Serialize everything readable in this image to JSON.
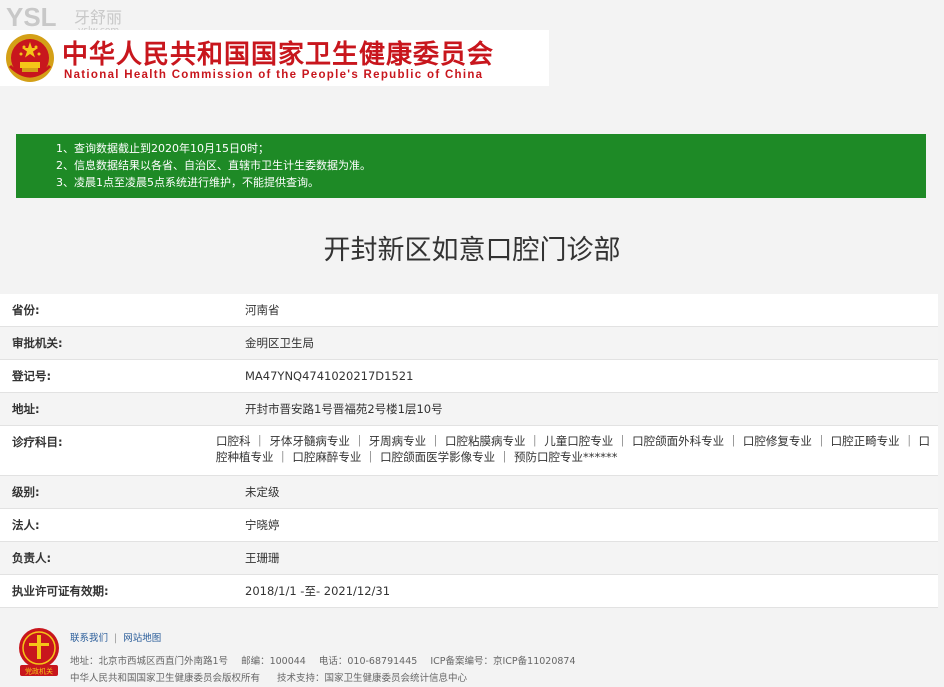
{
  "watermark": {
    "logo": "YSL",
    "name": "牙舒丽",
    "url": "yslw.com"
  },
  "header": {
    "title_cn": "中华人民共和国国家卫生健康委员会",
    "title_en": "National Health Commission of the People's Republic of China"
  },
  "notice": {
    "lines": [
      "1、查询数据截止到2020年10月15日0时；",
      "2、信息数据结果以各省、自治区、直辖市卫生计生委数据为准。",
      "3、凌晨1点至凌晨5点系统进行维护，不能提供查询。"
    ]
  },
  "clinic": {
    "name": "开封新区如意口腔门诊部",
    "fields": {
      "province_label": "省份:",
      "province": "河南省",
      "authority_label": "审批机关:",
      "authority": "金明区卫生局",
      "reg_label": "登记号:",
      "reg_no": "MA47YNQ4741020217D1521",
      "address_label": "地址:",
      "address": "开封市晋安路1号晋福苑2号楼1层10号",
      "dept_label": "诊疗科目:",
      "dept_line1": "口腔科 ｜ 牙体牙髓病专业 ｜ 牙周病专业 ｜ 口腔粘膜病专业 ｜ 儿童口腔专业 ｜ 口腔颌面外科专业 ｜ 口腔修复专业 ｜ 口腔正畸专业 ｜ 口",
      "dept_line2": "腔种植专业 ｜ 口腔麻醉专业 ｜ 口腔颌面医学影像专业 ｜ 预防口腔专业******",
      "level_label": "级别:",
      "level": "未定级",
      "legal_label": "法人:",
      "legal_person": "宁晓婷",
      "head_label": "负责人:",
      "person_in_charge": "王珊珊",
      "license_label": "执业许可证有效期:",
      "license_validity": "2018/1/1 -至- 2021/12/31"
    }
  },
  "footer": {
    "logo_text": "党政机关",
    "link_contact": "联系我们",
    "link_sitemap": "网站地图",
    "sep": "|",
    "address": "地址：北京市西城区西直门外南路1号",
    "postcode": "邮编：100044",
    "phone": "电话：010-68791445",
    "icp": "ICP备案编号：京ICP备11020874",
    "copyright": "中华人民共和国国家卫生健康委员会版权所有",
    "support": "技术支持：国家卫生健康委员会统计信息中心"
  },
  "colors": {
    "brand_red": "#c8161d",
    "notice_green": "#1e8a26",
    "link_blue": "#2a5d9a"
  }
}
